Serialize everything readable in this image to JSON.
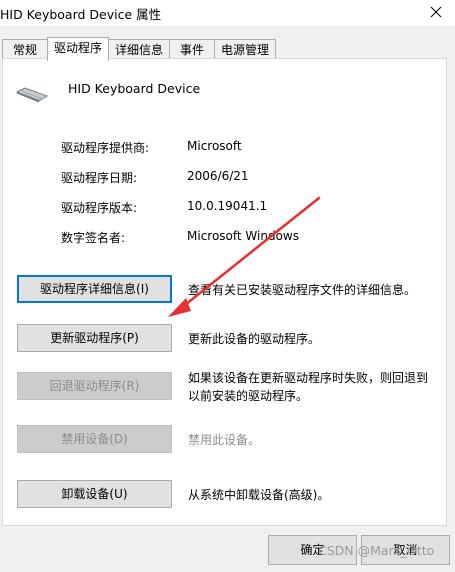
{
  "window": {
    "title": "HID Keyboard Device 属性",
    "close_icon": "close-icon"
  },
  "tabs": [
    {
      "label": "常规",
      "active": false
    },
    {
      "label": "驱动程序",
      "active": true
    },
    {
      "label": "详细信息",
      "active": false
    },
    {
      "label": "事件",
      "active": false
    },
    {
      "label": "电源管理",
      "active": false
    }
  ],
  "device": {
    "name": "HID Keyboard Device",
    "icon": "keyboard-icon"
  },
  "properties": [
    {
      "label": "驱动程序提供商:",
      "value": "Microsoft"
    },
    {
      "label": "驱动程序日期:",
      "value": "2006/6/21"
    },
    {
      "label": "驱动程序版本:",
      "value": "10.0.19041.1"
    },
    {
      "label": "数字签名者:",
      "value": "Microsoft Windows"
    }
  ],
  "actions": [
    {
      "label": "驱动程序详细信息(I)",
      "description": "查看有关已安装驱动程序文件的详细信息。",
      "enabled": true
    },
    {
      "label": "更新驱动程序(P)",
      "description": "更新此设备的驱动程序。",
      "enabled": true
    },
    {
      "label": "回退驱动程序(R)",
      "description_line1": "如果该设备在更新驱动程序时失败，则回退到",
      "description_line2": "以前安装的驱动程序。",
      "enabled": false
    },
    {
      "label": "禁用设备(D)",
      "description": "禁用此设备。",
      "enabled": false
    },
    {
      "label": "卸载设备(U)",
      "description": "从系统中卸载设备(高级)。",
      "enabled": true
    }
  ],
  "footer": {
    "ok_label": "确定",
    "cancel_label": "取消"
  },
  "watermark": "CSDN @Marx_Otto",
  "colors": {
    "annotation_arrow": "#e8302f",
    "focus_border": "#0078d7"
  }
}
